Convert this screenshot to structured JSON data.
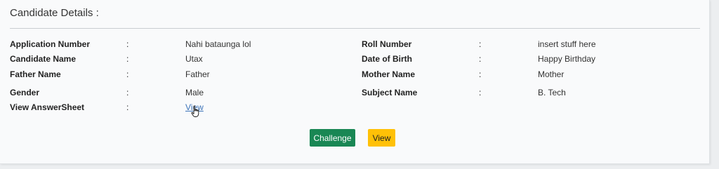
{
  "header": {
    "title": "Candidate Details :"
  },
  "details": {
    "colon": ":",
    "application_number": {
      "label": "Application Number",
      "value": "Nahi bataunga lol"
    },
    "roll_number": {
      "label": "Roll Number",
      "value": "insert stuff here"
    },
    "candidate_name": {
      "label": "Candidate Name",
      "value": "Utax"
    },
    "date_of_birth": {
      "label": "Date of Birth",
      "value": "Happy Birthday"
    },
    "father_name": {
      "label": "Father Name",
      "value": "Father"
    },
    "mother_name": {
      "label": "Mother Name",
      "value": "Mother"
    },
    "gender": {
      "label": "Gender",
      "value": "Male"
    },
    "subject_name": {
      "label": "Subject Name",
      "value": "B. Tech"
    },
    "answersheet": {
      "label": "View AnswerSheet",
      "link": "View"
    }
  },
  "actions": {
    "challenge_label": "Challenge",
    "view_label": "View"
  },
  "colors": {
    "challenge": "#198754",
    "view": "#ffc107",
    "link": "#3c73b8"
  }
}
